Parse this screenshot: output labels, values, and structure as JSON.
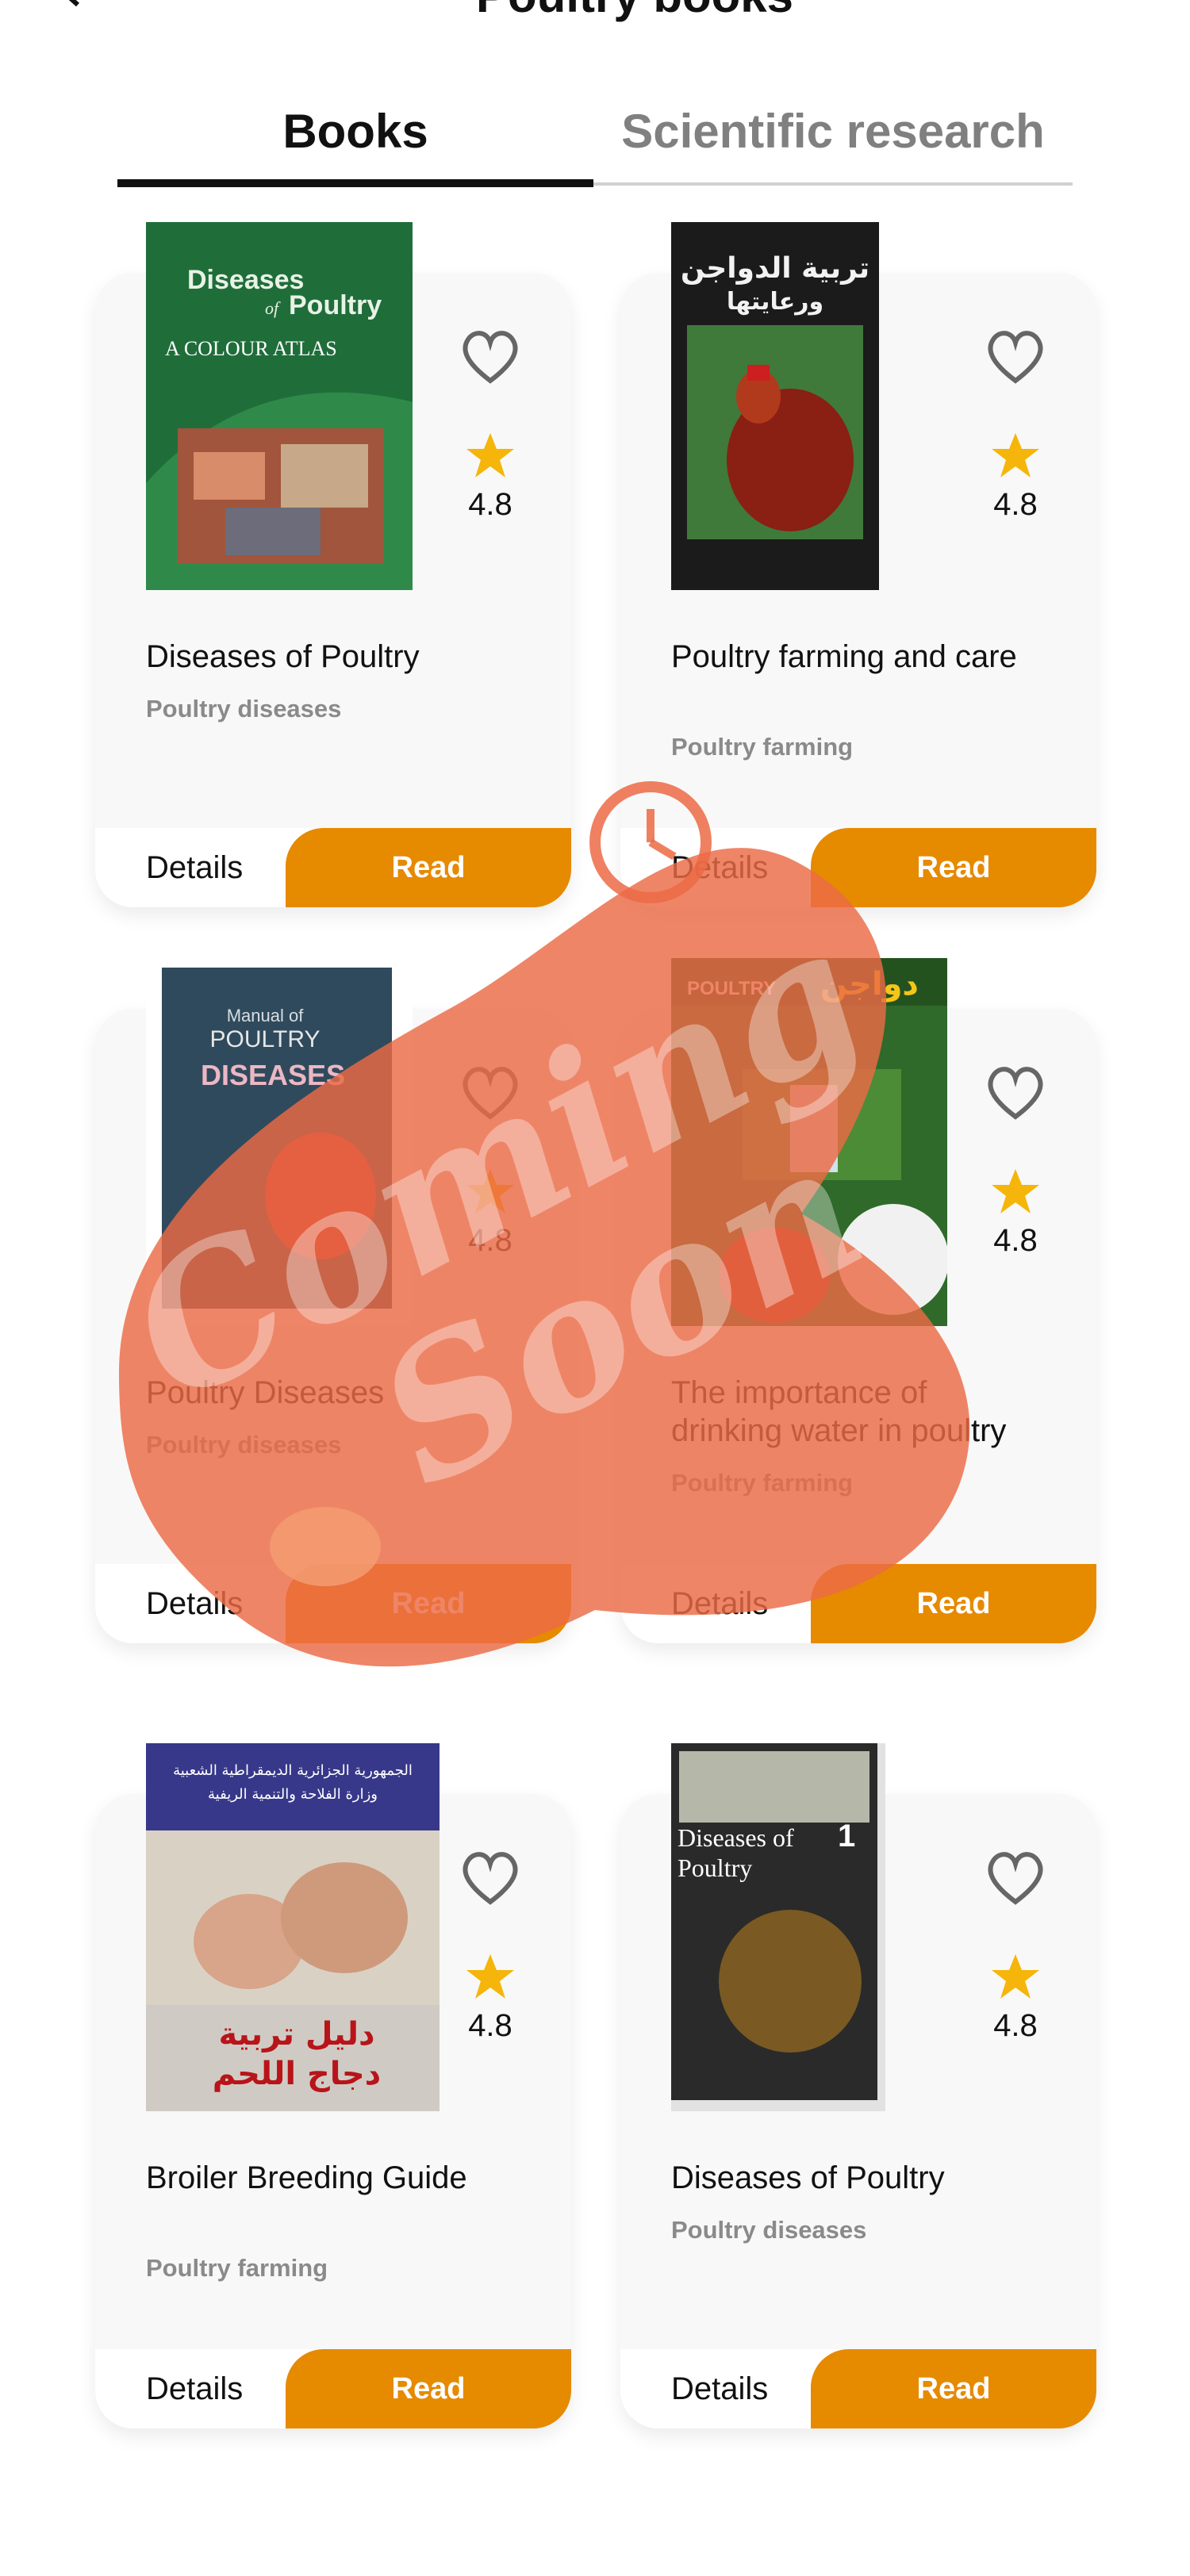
{
  "header": {
    "title": "Poultry books"
  },
  "tabs": [
    {
      "label": "Books",
      "active": true
    },
    {
      "label": "Scientific research",
      "active": false
    }
  ],
  "books": [
    {
      "title": "Diseases of Poultry",
      "category": "Poultry diseases",
      "rating": "4.8",
      "details_label": "Details",
      "read_label": "Read",
      "cover_text": "Diseases of Poultry A COLOUR ATLAS"
    },
    {
      "title": "Poultry farming and care",
      "category": "Poultry farming",
      "rating": "4.8",
      "details_label": "Details",
      "read_label": "Read",
      "cover_text": "تربية الدواجن ورعايتها"
    },
    {
      "title": "Poultry Diseases",
      "category": "Poultry diseases",
      "rating": "4.8",
      "details_label": "Details",
      "read_label": "Read",
      "cover_text": "POULTRY DISEASES"
    },
    {
      "title": "The importance of drinking water in poultry",
      "category": "Poultry farming",
      "rating": "4.8",
      "details_label": "Details",
      "read_label": "Read",
      "cover_text": "دواجن"
    },
    {
      "title": "Broiler Breeding Guide",
      "category": "Poultry farming",
      "rating": "4.8",
      "details_label": "Details",
      "read_label": "Read",
      "cover_text": "دليل تربية دجاج اللحم"
    },
    {
      "title": "Diseases of Poultry",
      "category": "Poultry diseases",
      "rating": "4.8",
      "details_label": "Details",
      "read_label": "Read",
      "cover_text": "Diseases of Poultry"
    }
  ],
  "overlay": {
    "text": "Coming Soon",
    "color": "#ec6a45"
  },
  "colors": {
    "accent": "#e68a00",
    "star": "#f5b50a",
    "card_bg": "#f8f8f8"
  },
  "icons": {
    "back": "back-arrow-icon",
    "favorite": "heart-outline-icon",
    "rating": "star-icon"
  }
}
